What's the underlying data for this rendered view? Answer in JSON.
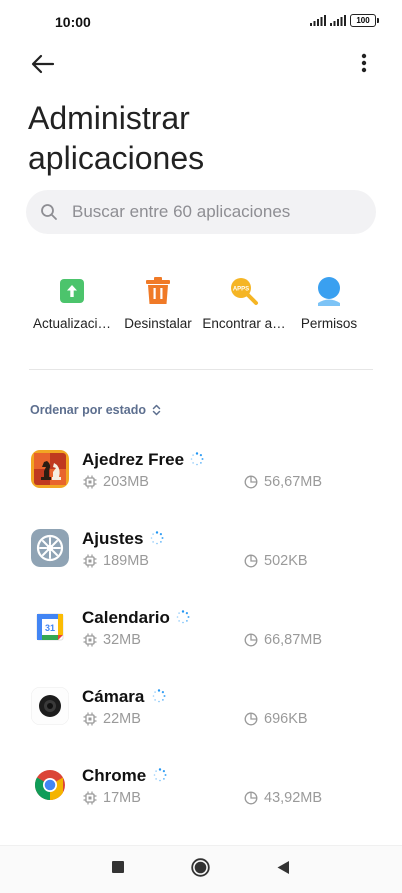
{
  "status_bar": {
    "time": "10:00",
    "battery": "100"
  },
  "header": {
    "title": "Administrar aplicaciones"
  },
  "search": {
    "placeholder": "Buscar entre 60 aplicaciones"
  },
  "actions": [
    {
      "label": "Actualizaci…",
      "icon": "update-icon",
      "color": "#4cc46c"
    },
    {
      "label": "Desinstalar",
      "icon": "trash-icon",
      "color": "#f07a27"
    },
    {
      "label": "Encontrar a…",
      "icon": "find-apps-icon",
      "color": "#f5b524"
    },
    {
      "label": "Permisos",
      "icon": "permissions-icon",
      "color": "#3aa0f0"
    }
  ],
  "sort": {
    "label": "Ordenar por estado"
  },
  "apps": [
    {
      "name": "Ajedrez Free",
      "storage": "203MB",
      "data": "56,67MB",
      "icon": "chess-icon"
    },
    {
      "name": "Ajustes",
      "storage": "189MB",
      "data": "502KB",
      "icon": "settings-gear-icon"
    },
    {
      "name": "Calendario",
      "storage": "32MB",
      "data": "66,87MB",
      "icon": "calendar-icon"
    },
    {
      "name": "Cámara",
      "storage": "22MB",
      "data": "696KB",
      "icon": "camera-icon"
    },
    {
      "name": "Chrome",
      "storage": "17MB",
      "data": "43,92MB",
      "icon": "chrome-icon"
    }
  ],
  "colors": {
    "accent": "#2196f3",
    "sort_text": "#5d6f8f",
    "meta_text": "#9a9a9a"
  }
}
